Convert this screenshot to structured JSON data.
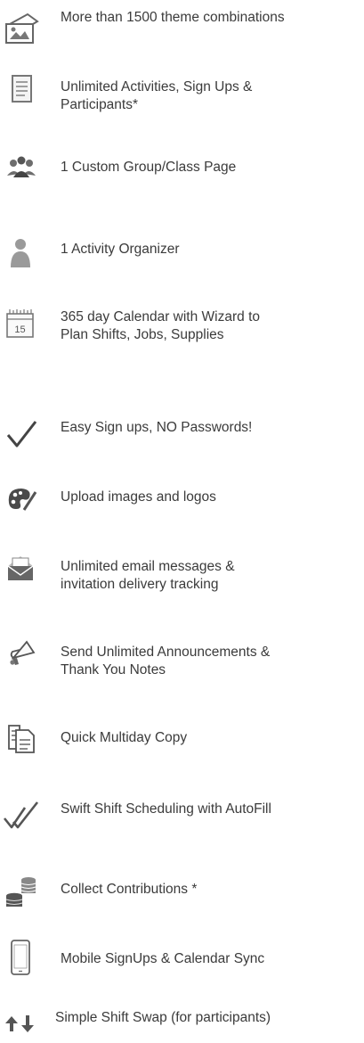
{
  "features": [
    {
      "label": "More than 1500 theme combinations",
      "icon": "theme-picture-icon"
    },
    {
      "label": "Unlimited Activities, Sign Ups &\nParticipants*",
      "icon": "document-icon"
    },
    {
      "label": "1 Custom Group/Class Page",
      "icon": "group-icon"
    },
    {
      "label": "1 Activity Organizer",
      "icon": "person-icon"
    },
    {
      "label": "365 day Calendar with Wizard to\nPlan Shifts, Jobs, Supplies",
      "icon": "calendar-icon",
      "calendar_day": "15"
    },
    {
      "label": "Easy Sign ups, NO Passwords!",
      "icon": "checkmark-icon"
    },
    {
      "label": "Upload images and logos",
      "icon": "palette-icon"
    },
    {
      "label": "Unlimited email messages &\ninvitation delivery tracking",
      "icon": "envelope-icon"
    },
    {
      "label": "Send Unlimited Announcements &\nThank You Notes",
      "icon": "megaphone-icon"
    },
    {
      "label": "Quick Multiday Copy",
      "icon": "copy-documents-icon"
    },
    {
      "label": "Swift Shift Scheduling with AutoFill",
      "icon": "double-checkmark-icon"
    },
    {
      "label": "Collect Contributions *",
      "icon": "coins-icon"
    },
    {
      "label": "Mobile SignUps & Calendar Sync",
      "icon": "mobile-phone-icon"
    },
    {
      "label": "Simple Shift Swap (for participants)",
      "icon": "swap-arrows-icon"
    }
  ]
}
